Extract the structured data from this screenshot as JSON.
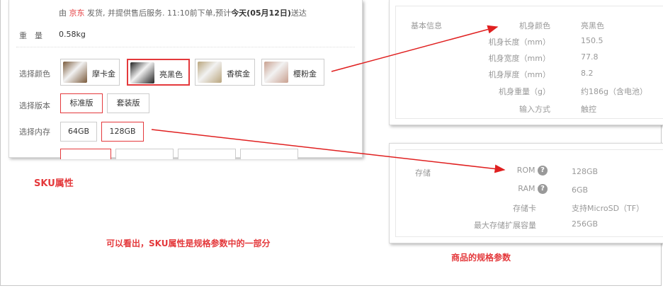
{
  "sku_panel": {
    "delivery": {
      "prefix": "由",
      "seller": "京东",
      "text": "发货, 并提供售后服务. 11:10前下单,预计",
      "bold": "今天(05月12日)",
      "suffix": "送达"
    },
    "weight_label": "重　量",
    "weight_value": "0.58kg",
    "color_label": "选择颜色",
    "colors": [
      {
        "label": "摩卡金",
        "selected": false,
        "tone": "#7a5a3a"
      },
      {
        "label": "亮黑色",
        "selected": true,
        "tone": "#222222"
      },
      {
        "label": "香槟金",
        "selected": false,
        "tone": "#b9a57c"
      },
      {
        "label": "樱粉金",
        "selected": false,
        "tone": "#c9a08f"
      }
    ],
    "version_label": "选择版本",
    "versions": [
      {
        "label": "标准版",
        "selected": true
      },
      {
        "label": "套装版",
        "selected": false
      }
    ],
    "memory_label": "选择内存",
    "memories": [
      {
        "label": "64GB",
        "selected": false
      },
      {
        "label": "128GB",
        "selected": true
      }
    ]
  },
  "annotations": {
    "sku_title": "SKU属性",
    "conclusion": "可以看出，SKU属性是规格参数中的一部分",
    "spec_title": "商品的规格参数"
  },
  "spec_top": {
    "group": "基本信息",
    "rows": [
      {
        "key": "机身颜色",
        "value": "亮黑色"
      },
      {
        "key": "机身长度（mm）",
        "value": "150.5"
      },
      {
        "key": "机身宽度（mm）",
        "value": "77.8"
      },
      {
        "key": "机身厚度（mm）",
        "value": "8.2"
      },
      {
        "key": "机身重量（g）",
        "value": "约186g（含电池）"
      },
      {
        "key": "输入方式",
        "value": "触控"
      }
    ]
  },
  "spec_bottom": {
    "group": "存储",
    "rows": [
      {
        "key": "ROM",
        "help": "?",
        "value": "128GB"
      },
      {
        "key": "RAM",
        "help": "?",
        "value": "6GB"
      },
      {
        "key": "存储卡",
        "value": "支持MicroSD（TF）"
      },
      {
        "key": "最大存储扩展容量",
        "value": "256GB"
      }
    ]
  },
  "colors": {
    "accent": "#e4393c",
    "arrow": "#e02020"
  }
}
